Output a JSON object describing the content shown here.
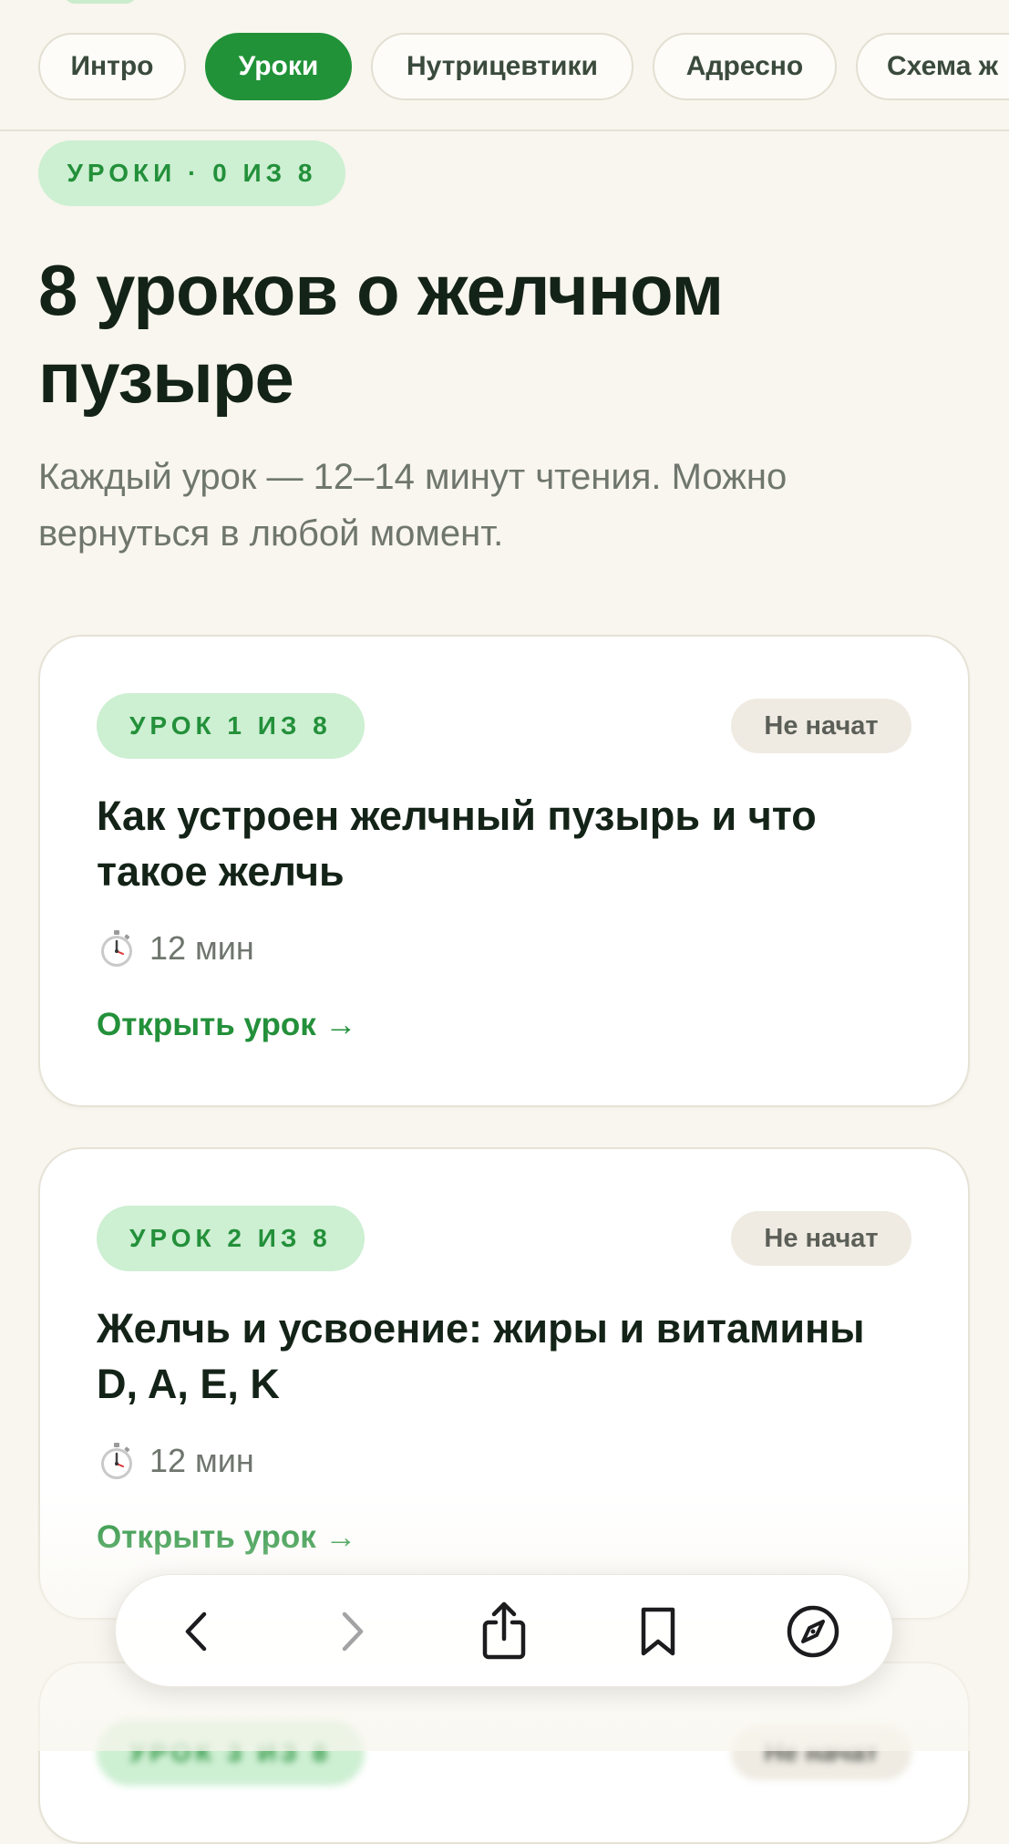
{
  "tabs": [
    {
      "label": "Интро",
      "active": false
    },
    {
      "label": "Уроки",
      "active": true
    },
    {
      "label": "Нутрицевтики",
      "active": false
    },
    {
      "label": "Адресно",
      "active": false
    },
    {
      "label": "Схема ж",
      "active": false
    }
  ],
  "section": {
    "badge": "УРОКИ · 0 ИЗ 8",
    "title": "8 уроков о желчном пузыре",
    "subtitle": "Каждый урок — 12–14 минут чтения. Можно вернуться в любой момент."
  },
  "lessons": [
    {
      "badge": "УРОК 1 ИЗ 8",
      "status": "Не начат",
      "title": "Как устроен желчный пузырь и что такое желчь",
      "duration": "12 мин",
      "link": "Открыть урок →"
    },
    {
      "badge": "УРОК 2 ИЗ 8",
      "status": "Не начат",
      "title": "Желчь и усвоение: жиры и витамины D, A, E, K",
      "duration": "12 мин",
      "link": "Открыть урок →"
    },
    {
      "badge": "УРОК 3 ИЗ 8",
      "status": "Не начат"
    }
  ],
  "toolbar": {
    "back_icon": "chevron-left-icon",
    "forward_icon": "chevron-right-icon",
    "share_icon": "share-icon",
    "bookmarks_icon": "bookmark-icon",
    "safari_icon": "compass-icon"
  },
  "colors": {
    "accent": "#219238",
    "accent_text": "#23903a",
    "badge_bg": "#cdefd2",
    "page_bg": "#f8f6ee",
    "status_bg": "#efebe2"
  }
}
